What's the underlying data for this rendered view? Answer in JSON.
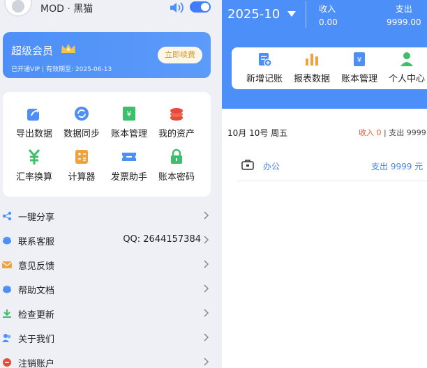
{
  "drawer": {
    "user": {
      "name_text": "MOD · 黑猫"
    },
    "sound_toggle": {
      "on": true
    },
    "vip": {
      "title": "超级会员",
      "subtitle": "已开通VIP | 有效期至: 2025-06-13",
      "renew_label": "立即续费"
    },
    "tools": [
      {
        "label": "导出数据",
        "icon": "export-icon"
      },
      {
        "label": "数据同步",
        "icon": "sync-icon"
      },
      {
        "label": "账本管理",
        "icon": "ledger-icon"
      },
      {
        "label": "我的资产",
        "icon": "assets-icon"
      },
      {
        "label": "汇率换算",
        "icon": "exchange-icon"
      },
      {
        "label": "计算器",
        "icon": "calculator-icon"
      },
      {
        "label": "发票助手",
        "icon": "invoice-icon"
      },
      {
        "label": "账本密码",
        "icon": "lock-icon"
      }
    ],
    "menu": [
      {
        "label": "一键分享",
        "value": "",
        "icon": "share-icon"
      },
      {
        "label": "联系客服",
        "value": "QQ: 2644157384",
        "icon": "support-icon"
      },
      {
        "label": "意见反馈",
        "value": "",
        "icon": "mail-icon"
      },
      {
        "label": "帮助文档",
        "value": "",
        "icon": "help-icon"
      },
      {
        "label": "检查更新",
        "value": "",
        "icon": "download-icon"
      },
      {
        "label": "关于我们",
        "value": "",
        "icon": "users-icon"
      },
      {
        "label": "注销账户",
        "value": "",
        "icon": "delete-account-icon"
      }
    ]
  },
  "main": {
    "month": "2025-10",
    "income": {
      "label": "收入",
      "value": "0.00"
    },
    "expense": {
      "label": "支出",
      "value": "9999.00"
    },
    "quick_actions": [
      {
        "label": "新增记账",
        "icon": "add-record-icon"
      },
      {
        "label": "报表数据",
        "icon": "report-icon"
      },
      {
        "label": "账本管理",
        "icon": "ledger-book-icon"
      },
      {
        "label": "个人中心",
        "icon": "person-icon"
      }
    ],
    "day": {
      "date": "10月 10号  周五",
      "income_text": "收入 0",
      "separator": " | ",
      "expense_text": "支出 9999"
    },
    "entries": [
      {
        "category": "办公",
        "amount": "支出 9999 元",
        "icon": "briefcase-icon"
      }
    ]
  },
  "colors": {
    "primary": "#4d8ff8",
    "drawer_bg": "#eef0f5",
    "income_red": "#e0563a",
    "renew_gold": "#d49a33"
  }
}
